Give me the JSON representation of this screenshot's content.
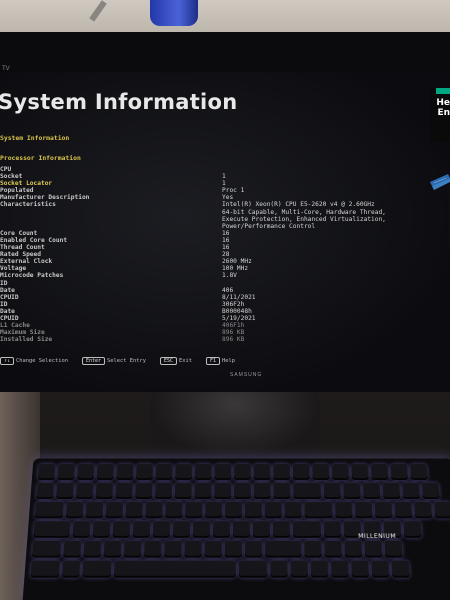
{
  "bios": {
    "brand_label": "TV",
    "title": "System Information",
    "vendor_logo": {
      "line1": "He",
      "line2": "En"
    },
    "breadcrumbs": [
      "System Information",
      "Processor Information"
    ],
    "rows": [
      {
        "label": "CPU",
        "value": ""
      },
      {
        "label": "Socket",
        "value": "1"
      },
      {
        "label": "Socket Locator",
        "value": "1",
        "highlight": true
      },
      {
        "label": "Populated",
        "value": "Proc 1"
      },
      {
        "label": "Manufacturer Description",
        "value": "Yes"
      },
      {
        "label": "Characteristics",
        "value": "Intel(R) Xeon(R) CPU E5-2620 v4 @ 2.60GHz"
      },
      {
        "label": "",
        "value": "64-bit Capable, Multi-Core, Hardware Thread,"
      },
      {
        "label": "",
        "value": "Execute Protection, Enhanced Virtualization,"
      },
      {
        "label": "",
        "value": "Power/Performance Control"
      },
      {
        "label": "Core Count",
        "value": "16"
      },
      {
        "label": "Enabled Core Count",
        "value": "16"
      },
      {
        "label": "Thread Count",
        "value": "16"
      },
      {
        "label": "Rated Speed",
        "value": "28"
      },
      {
        "label": "External Clock",
        "value": "2600 MHz"
      },
      {
        "label": "Voltage",
        "value": "100 MHz"
      },
      {
        "label": "Microcode Patches",
        "value": "1.8V"
      },
      {
        "label": "  ID",
        "value": ""
      },
      {
        "label": "  Date",
        "value": "406"
      },
      {
        "label": "  CPUID",
        "value": "8/11/2021"
      },
      {
        "label": "  ID",
        "value": "306F2h"
      },
      {
        "label": "  Date",
        "value": "B000048h"
      },
      {
        "label": "  CPUID",
        "value": "5/19/2021"
      },
      {
        "label": "L1 Cache",
        "value": "406F1h",
        "dim": true
      },
      {
        "label": "  Maximum Size",
        "value": "896 KB",
        "dim": true
      },
      {
        "label": "  Installed Size",
        "value": "896 KB",
        "dim": true
      }
    ],
    "footer": [
      {
        "key": "↑↓",
        "label": "Change Selection"
      },
      {
        "key": "Enter",
        "label": "Select Entry"
      },
      {
        "key": "ESC",
        "label": "Exit"
      },
      {
        "key": "F1",
        "label": "Help"
      }
    ]
  },
  "monitor_logo": "SAMSUNG",
  "keyboard_brand": "MILLENIUM",
  "colors": {
    "highlight": "#e0cc4f",
    "screen_bg": "#0c0c10",
    "hpe_green": "#01a982",
    "keyboard_glow": "#b9a8ff"
  }
}
